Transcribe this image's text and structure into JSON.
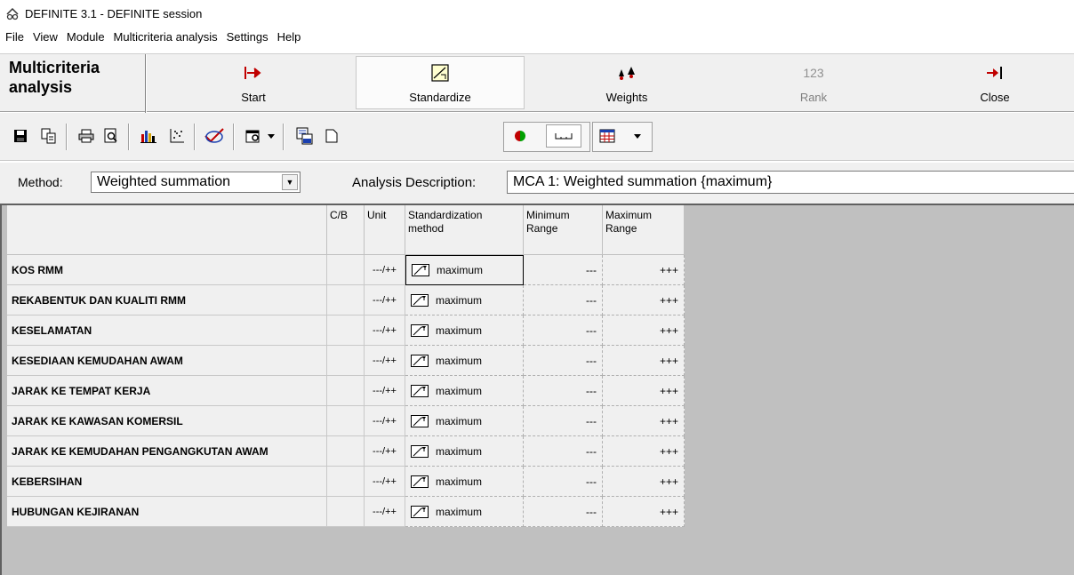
{
  "window": {
    "title": "DEFINITE 3.1 - DEFINITE session",
    "app_icon": "definite-app-icon"
  },
  "menu": [
    "File",
    "View",
    "Module",
    "Multicriteria analysis",
    "Settings",
    "Help"
  ],
  "module_bar": {
    "title_line1": "Multicriteria",
    "title_line2": "analysis",
    "buttons": [
      {
        "label": "Start",
        "icon": "start-arrow-icon",
        "state": "normal"
      },
      {
        "label": "Standardize",
        "icon": "standardize-icon",
        "state": "selected"
      },
      {
        "label": "Weights",
        "icon": "weights-icon",
        "state": "normal"
      },
      {
        "label": "Rank",
        "icon": "rank-123-icon",
        "state": "disabled",
        "icon_text": "123"
      },
      {
        "label": "Close",
        "icon": "close-arrow-icon",
        "state": "normal"
      }
    ]
  },
  "toolbar_icons": [
    "save-icon",
    "copy-icon",
    "print-icon",
    "print-preview-icon",
    "bar-chart-icon",
    "scatter-plot-icon",
    "check-signature-icon",
    "properties-icon",
    "dropdown-arrow-icon",
    "paste-icon",
    "new-page-icon",
    "color-circle-icon",
    "scale-ruler-icon",
    "table-grid-icon",
    "dropdown-arrow-icon"
  ],
  "method": {
    "label": "Method:",
    "value": "Weighted summation",
    "description_label": "Analysis Description:",
    "description_value": "MCA 1: Weighted summation {maximum}"
  },
  "grid": {
    "headers": {
      "cb": "C/B",
      "unit": "Unit",
      "std_line1": "Standardization",
      "std_line2": "method",
      "min_line1": "Minimum",
      "min_line2": "Range",
      "max_line1": "Maximum",
      "max_line2": "Range"
    },
    "rows": [
      {
        "name": "KOS RMM",
        "unit": "---/++",
        "method": "maximum",
        "min": "---",
        "max": "+++"
      },
      {
        "name": "REKABENTUK DAN KUALITI RMM",
        "unit": "---/++",
        "method": "maximum",
        "min": "---",
        "max": "+++"
      },
      {
        "name": "KESELAMATAN",
        "unit": "---/++",
        "method": "maximum",
        "min": "---",
        "max": "+++"
      },
      {
        "name": "KESEDIAAN KEMUDAHAN AWAM",
        "unit": "---/++",
        "method": "maximum",
        "min": "---",
        "max": "+++"
      },
      {
        "name": "JARAK KE TEMPAT KERJA",
        "unit": "---/++",
        "method": "maximum",
        "min": "---",
        "max": "+++"
      },
      {
        "name": "JARAK KE KAWASAN KOMERSIL",
        "unit": "---/++",
        "method": "maximum",
        "min": "---",
        "max": "+++"
      },
      {
        "name": "JARAK KE KEMUDAHAN PENGANGKUTAN AWAM",
        "unit": "---/++",
        "method": "maximum",
        "min": "---",
        "max": "+++"
      },
      {
        "name": "KEBERSIHAN",
        "unit": "---/++",
        "method": "maximum",
        "min": "---",
        "max": "+++"
      },
      {
        "name": "HUBUNGAN KEJIRANAN",
        "unit": "---/++",
        "method": "maximum",
        "min": "---",
        "max": "+++"
      }
    ]
  }
}
